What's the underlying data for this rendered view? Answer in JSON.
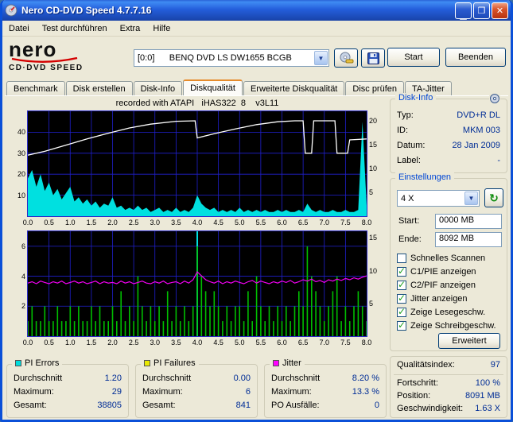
{
  "window": {
    "title": "Nero CD-DVD Speed 4.7.7.16"
  },
  "menu": {
    "items": [
      "Datei",
      "Test durchführen",
      "Extra",
      "Hilfe"
    ]
  },
  "logo": {
    "name": "nero",
    "sub": "CD·DVD SPEED"
  },
  "toolbar": {
    "drive": "[0:0]      BENQ DVD LS DW1655 BCGB",
    "start": "Start",
    "beenden": "Beenden"
  },
  "tabs": {
    "items": [
      "Benchmark",
      "Disk erstellen",
      "Disk-Info",
      "Diskqualität",
      "Erweiterte Diskqualität",
      "Disc prüfen",
      "TA-Jitter"
    ],
    "selected": "Diskqualität"
  },
  "disk_info": {
    "title": "Disk-Info",
    "rows": [
      [
        "Typ:",
        "DVD+R DL"
      ],
      [
        "ID:",
        "MKM 003"
      ],
      [
        "Datum:",
        "28 Jan 2009"
      ],
      [
        "Label:",
        "-"
      ]
    ]
  },
  "einstellungen": {
    "title": "Einstellungen",
    "speed": "4 X",
    "start_label": "Start:",
    "start_value": "0000 MB",
    "ende_label": "Ende:",
    "ende_value": "8092 MB",
    "checkboxes": [
      {
        "label": "Schnelles Scannen",
        "checked": false
      },
      {
        "label": "C1/PIE anzeigen",
        "checked": true
      },
      {
        "label": "C2/PIF anzeigen",
        "checked": true
      },
      {
        "label": "Jitter anzeigen",
        "checked": true
      },
      {
        "label": "Zeige Lesegeschw.",
        "checked": true
      },
      {
        "label": "Zeige Schreibgeschw.",
        "checked": true
      }
    ],
    "erweitert": "Erweitert"
  },
  "quality": {
    "label": "Qualitätsindex:",
    "value": "97"
  },
  "progress": {
    "rows": [
      [
        "Fortschritt:",
        "100 %"
      ],
      [
        "Position:",
        "8091 MB"
      ],
      [
        "Geschwindigkeit:",
        "1.63 X"
      ]
    ]
  },
  "stats": {
    "boxes": [
      {
        "title": "PI Errors",
        "color": "#00dcdc",
        "rows": [
          [
            "Durchschnitt",
            "1.20"
          ],
          [
            "Maximum:",
            "29"
          ],
          [
            "Gesamt:",
            "38805"
          ]
        ]
      },
      {
        "title": "PI Failures",
        "color": "#e8e800",
        "rows": [
          [
            "Durchschnitt",
            "0.00"
          ],
          [
            "Maximum:",
            "6"
          ],
          [
            "Gesamt:",
            "841"
          ]
        ]
      },
      {
        "title": "Jitter",
        "color": "#ff00ff",
        "rows": [
          [
            "Durchschnitt",
            "8.20 %"
          ],
          [
            "Maximum:",
            "13.3 %"
          ],
          [
            "PO Ausfälle:",
            "0"
          ]
        ]
      }
    ]
  },
  "chart_data": [
    {
      "type": "area",
      "title": "recorded with ATAPI   iHAS322  8    v3L11",
      "x_range": [
        0,
        8
      ],
      "x_ticks": [
        "0.0",
        "0.5",
        "1.0",
        "1.5",
        "2.0",
        "2.5",
        "3.0",
        "3.5",
        "4.0",
        "4.5",
        "5.0",
        "5.5",
        "6.0",
        "6.5",
        "7.0",
        "7.5",
        "8.0"
      ],
      "left_axis": {
        "name": "PI Errors",
        "ticks": [
          40,
          30,
          20,
          10
        ],
        "max": 50
      },
      "right_axis": {
        "name": "Speed X",
        "ticks": [
          20,
          15,
          10,
          5
        ],
        "max": 22
      },
      "grid": true,
      "series_pie_errors": [
        18,
        22,
        14,
        20,
        12,
        16,
        10,
        13,
        8,
        11,
        14,
        7,
        9,
        6,
        8,
        5,
        7,
        4,
        6,
        5,
        9,
        4,
        5,
        3,
        4,
        3,
        5,
        3,
        4,
        2,
        3,
        4,
        2,
        3,
        2,
        4,
        2,
        3,
        2,
        4,
        10,
        6,
        4,
        3,
        4,
        2,
        3,
        2,
        3,
        2,
        4,
        2,
        3,
        2,
        3,
        2,
        3,
        2,
        2,
        3,
        2,
        3,
        2,
        2,
        3,
        2,
        6,
        3,
        2,
        3,
        2,
        2,
        3,
        2,
        2,
        3,
        2,
        2,
        3,
        45,
        5
      ],
      "series_speed_line": [
        [
          0,
          12.8
        ],
        [
          0.4,
          13.6
        ],
        [
          0.9,
          14.9
        ],
        [
          1.4,
          16.2
        ],
        [
          1.9,
          17.4
        ],
        [
          2.4,
          18.5
        ],
        [
          2.9,
          19.3
        ],
        [
          3.5,
          19.9
        ],
        [
          3.95,
          20.0
        ],
        [
          4.0,
          16.4
        ],
        [
          4.4,
          17.3
        ],
        [
          4.9,
          18.3
        ],
        [
          5.4,
          19.2
        ],
        [
          5.9,
          19.8
        ],
        [
          6.3,
          20.0
        ],
        [
          6.5,
          20.0
        ],
        [
          6.55,
          13.2
        ],
        [
          6.7,
          13.2
        ],
        [
          6.75,
          20.0
        ],
        [
          7.25,
          20.0
        ],
        [
          7.3,
          13.2
        ],
        [
          7.55,
          13.2
        ],
        [
          7.6,
          16.0
        ],
        [
          8.0,
          16.2
        ]
      ],
      "colors": {
        "pie": "#00e0e0",
        "speed": "#ffffff",
        "grid": "#2020cf",
        "bg": "#000000"
      }
    },
    {
      "type": "bar",
      "x_range": [
        0,
        8
      ],
      "x_ticks": [
        "0.0",
        "0.5",
        "1.0",
        "1.5",
        "2.0",
        "2.5",
        "3.0",
        "3.5",
        "4.0",
        "4.5",
        "5.0",
        "5.5",
        "6.0",
        "6.5",
        "7.0",
        "7.5",
        "8.0"
      ],
      "left_axis": {
        "name": "PI Failures",
        "ticks": [
          6,
          4,
          2
        ],
        "max": 7
      },
      "right_axis": {
        "name": "Jitter %",
        "ticks": [
          15,
          10,
          5
        ],
        "max": 16
      },
      "grid": true,
      "layer_break_marker_x": 4.0,
      "series_pif_bars": [
        1,
        2,
        1,
        1,
        2,
        1,
        1,
        2,
        1,
        1,
        2,
        1,
        2,
        1,
        1,
        2,
        1,
        2,
        1,
        1,
        2,
        1,
        3,
        1,
        2,
        1,
        4,
        2,
        1,
        2,
        1,
        2,
        1,
        3,
        1,
        2,
        1,
        2,
        1,
        2,
        6,
        4,
        3,
        2,
        3,
        2,
        1,
        2,
        1,
        2,
        2,
        1,
        3,
        1,
        4,
        2,
        1,
        2,
        1,
        2,
        1,
        2,
        1,
        2,
        3,
        2,
        6,
        4,
        3,
        2,
        1,
        2,
        3,
        4,
        1,
        2,
        1,
        2,
        3,
        2,
        1
      ],
      "series_jitter_line": [
        8.1,
        8.3,
        8.0,
        8.4,
        8.2,
        8.0,
        8.3,
        8.1,
        8.4,
        8.0,
        8.2,
        8.4,
        8.1,
        8.3,
        8.0,
        8.2,
        8.4,
        8.0,
        8.3,
        8.1,
        8.2,
        8.0,
        8.4,
        8.1,
        8.3,
        8.0,
        8.2,
        8.4,
        8.1,
        8.0,
        8.3,
        8.1,
        8.4,
        8.0,
        8.2,
        8.3,
        8.0,
        8.4,
        8.1,
        8.6,
        9.8,
        9.2,
        8.6,
        8.3,
        8.1,
        8.4,
        8.0,
        8.3,
        8.1,
        8.4,
        8.2,
        8.0,
        8.3,
        8.5,
        8.1,
        8.4,
        8.2,
        8.0,
        8.3,
        8.1,
        8.4,
        8.2,
        8.5,
        8.1,
        8.3,
        8.6,
        8.4,
        8.7,
        8.3,
        8.5,
        8.2,
        8.6,
        8.4,
        8.7,
        8.5,
        8.8,
        8.6,
        8.9,
        8.7,
        9.0,
        9.2
      ],
      "colors": {
        "pif": "#00be00",
        "jitter": "#f000f0",
        "marker": "#00e0e0",
        "grid": "#2020cf",
        "bg": "#000000"
      }
    }
  ]
}
